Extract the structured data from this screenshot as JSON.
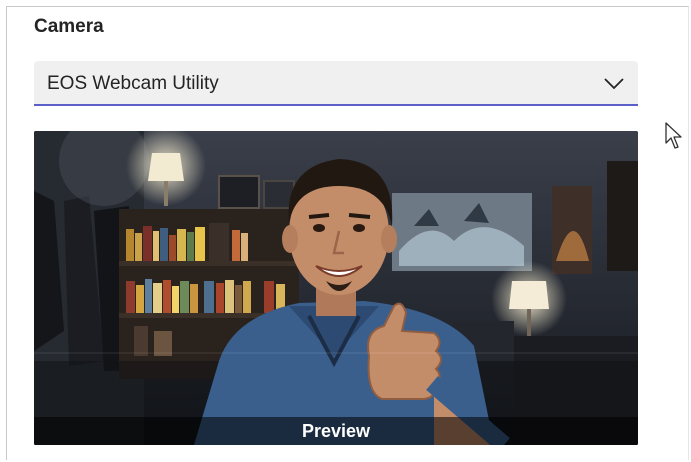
{
  "camera": {
    "heading": "Camera",
    "selected_device": "EOS Webcam Utility",
    "preview_label": "Preview"
  },
  "colors": {
    "accent": "#5b5fc7",
    "select_background": "#f0f0f0",
    "text": "#242424"
  },
  "icons": {
    "dropdown": "chevron-down-icon",
    "pointer": "mouse-pointer-icon"
  }
}
